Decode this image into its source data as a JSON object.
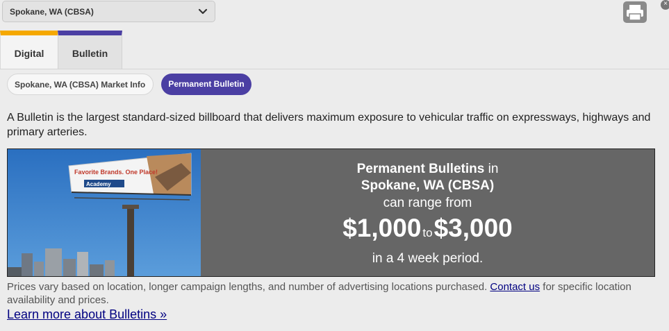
{
  "market_select": {
    "value": "Spokane, WA (CBSA)",
    "icon": "chevron-down-icon"
  },
  "toolbar": {
    "print_icon": "print-icon"
  },
  "tabs": [
    {
      "label": "Digital",
      "accent": "#f5a800"
    },
    {
      "label": "Bulletin",
      "accent": "#4b3fa3"
    }
  ],
  "pills": {
    "market_info": "Spokane, WA (CBSA) Market Info",
    "permanent_bulletin": "Permanent Bulletin"
  },
  "description": "A Bulletin is the largest standard-sized billboard that delivers maximum exposure to vehicular traffic on expressways, highways and primary arteries.",
  "billboard_image": {
    "headline": "Favorite Brands. One Place!",
    "brand": "Academy"
  },
  "banner": {
    "title_bold": "Permanent Bulletins",
    "title_rest": " in",
    "market": "Spokane, WA (CBSA)",
    "range_text": "can range from",
    "price_low": "$1,000",
    "to_text": "to",
    "price_high": "$3,000",
    "period_text": "in a 4 week period."
  },
  "note": {
    "text_before": "Prices vary based on location, longer campaign lengths, and number of advertising locations purchased. ",
    "contact_link": "Contact us",
    "text_after": " for specific location availability and prices."
  },
  "learn_more": "Learn more about Bulletins »",
  "colors": {
    "purple": "#4b3fa3",
    "orange": "#f5a800",
    "banner_bg": "#666666",
    "link": "#000080"
  }
}
